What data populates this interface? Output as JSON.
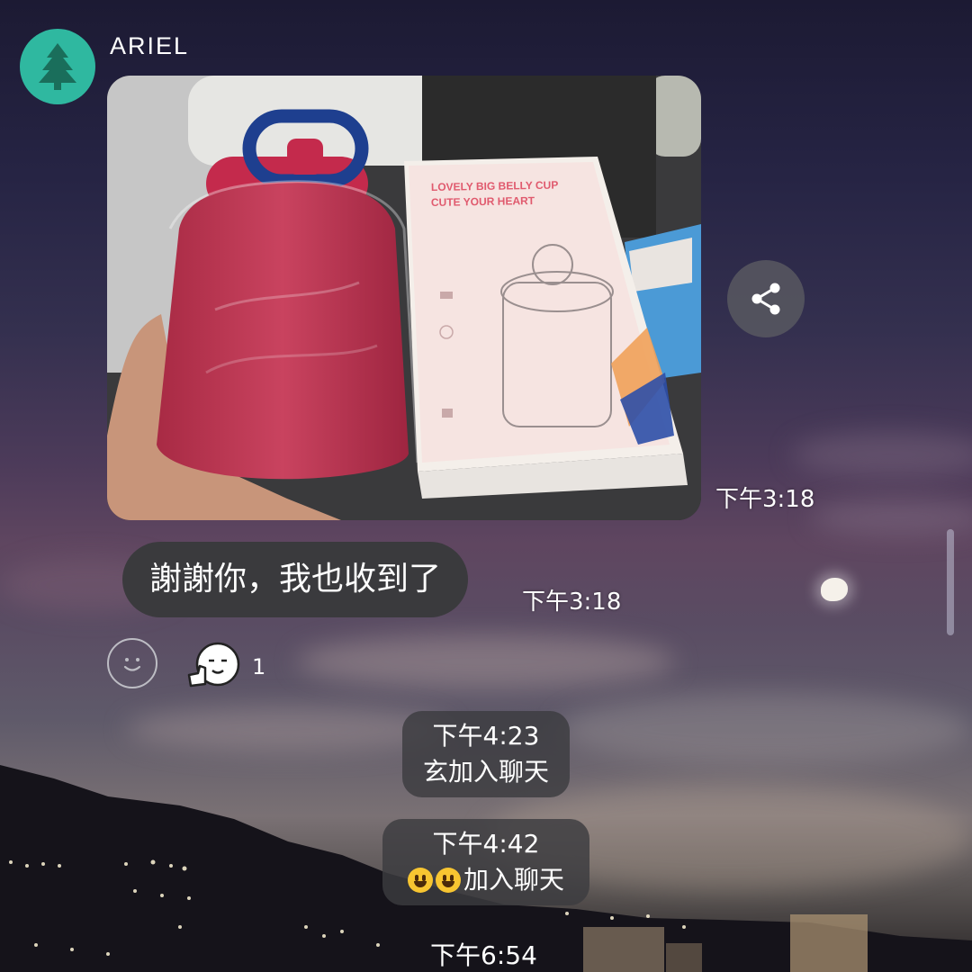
{
  "chat": {
    "sender_name": "ARIEL",
    "sender_avatar_icon": "tree-icon",
    "avatar_color": "#2fb8a0"
  },
  "photo_message": {
    "box_text_line1": "LOVELY BIG BELLY CUP",
    "box_text_line2": "CUTE YOUR HEART",
    "timestamp": "下午3:18",
    "share_icon": "share-icon"
  },
  "text_message": {
    "text": "謝謝你，我也收到了",
    "timestamp": "下午3:18"
  },
  "reactions": {
    "add_icon": "smiley-outline-icon",
    "sticker_icon": "thumbs-up-sticker-icon",
    "count": "1"
  },
  "system_notices": [
    {
      "time": "下午4:23",
      "text": "玄加入聊天"
    },
    {
      "time": "下午4:42",
      "text": "加入聊天",
      "emoji_icons": [
        "grinning-face-icon",
        "grinning-face-icon"
      ]
    },
    {
      "time": "下午6:54"
    }
  ]
}
